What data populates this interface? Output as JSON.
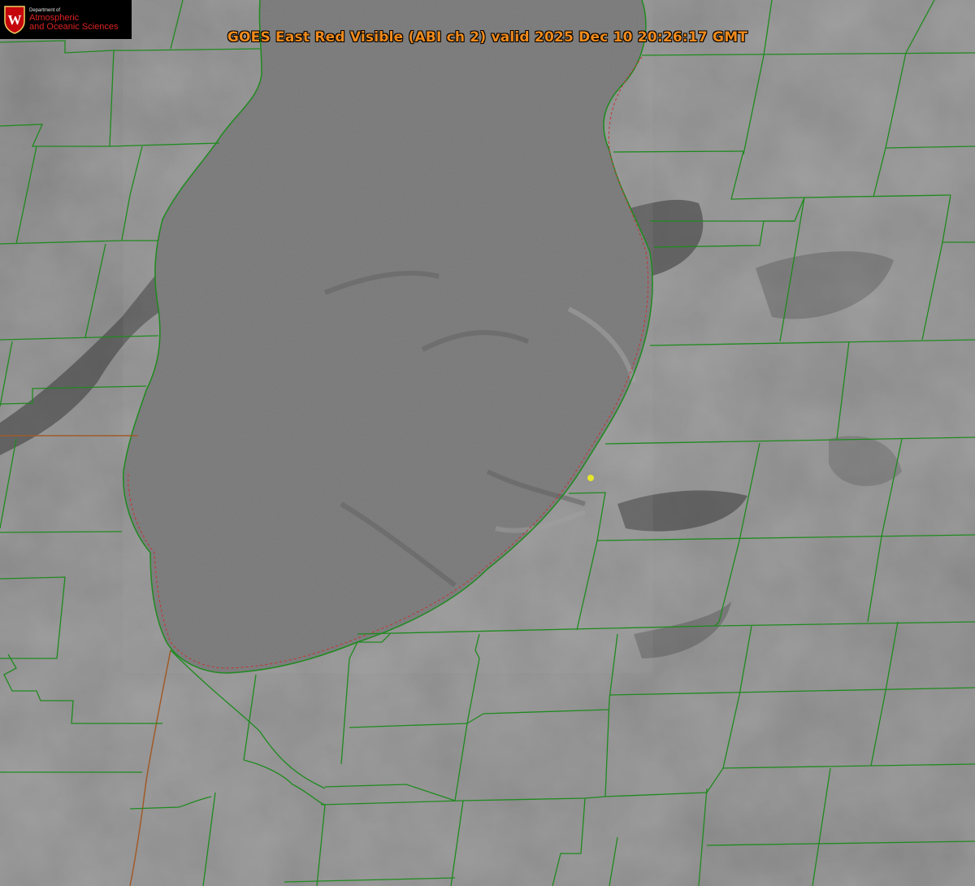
{
  "title": "GOES East Red Visible (ABI ch 2) valid 2025 Dec 10 20:26:17 GMT",
  "logo": {
    "line1": "Department of",
    "line2": "Atmospheric",
    "line3": "and Oceanic Sciences",
    "crest_letter": "W"
  },
  "colors": {
    "county_lines": "#1f8a1f",
    "state_lines": "#a05a28",
    "shoreline_dashes": "#c83232",
    "title": "#f08a1c",
    "marker": "#e6e62a",
    "lake": "#7a7a7a",
    "land": "#8e8e8e"
  },
  "map": {
    "feature": "lake",
    "marker": "yellow-dot"
  }
}
